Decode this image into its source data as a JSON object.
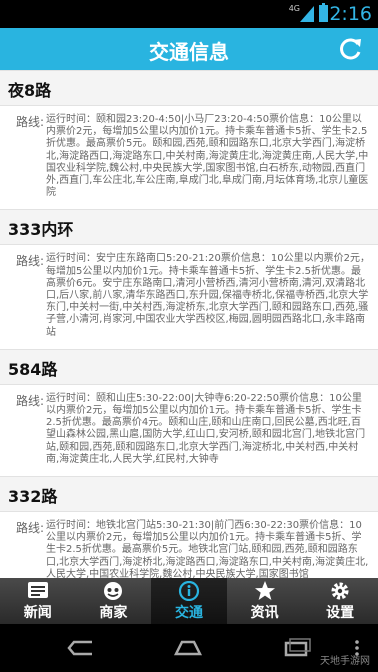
{
  "status_bar": {
    "network": "4G",
    "time": "12:16"
  },
  "header": {
    "title": "交通信息",
    "refresh_icon": "refresh-icon"
  },
  "routes": [
    {
      "name": "夜8路",
      "label": "路线:",
      "info": "运行时间：颐和园23:20-4:50|小马厂23:20-4:50票价信息：10公里以内票价2元，每增加5公里以内加价1元。持卡乘车普通卡5折、学生卡2.5折优惠。最高票价5元。颐和园,西苑,颐和园路东口,北京大学西门,海淀桥北,海淀路西口,海淀路东口,中关村南,海淀黄庄北,海淀黄庄南,人民大学,中国农业科学院,魏公村,中央民族大学,国家图书馆,白石桥东,动物园,西直门外,西直门,车公庄北,车公庄南,阜成门北,阜成门南,月坛体育场,北京儿童医院"
    },
    {
      "name": "333内环",
      "label": "路线:",
      "info": "运行时间：安宁庄东路南口5:20-21:20票价信息：10公里以内票价2元，每增加5公里以内加价1元。持卡乘车普通卡5折、学生卡2.5折优惠。最高票价6元。安宁庄东路南口,清河小营桥西,清河小营桥南,清河,双清路北口,后八家,前八家,清华东路西口,东升园,保福寺桥北,保福寺桥西,北京大学东门,中关村一街,中关村西,海淀桥东,北京大学西门,颐和园路东口,西苑,骚子营,小清河,肖家河,中国农业大学西校区,梅园,圆明园西路北口,永丰路南站"
    },
    {
      "name": "584路",
      "label": "路线:",
      "info": "运行时间：颐和山庄5:30-22:00|大钟寺6:20-22:50票价信息：10公里以内票价2元，每增加5公里以内加价1元。持卡乘车普通卡5折、学生卡2.5折优惠。最高票价4元。颐和山庄,颐和山庄南口,回民公墓,西北旺,百望山森林公园,黑山扈,国防大学,红山口,安河桥,颐和园北宫门,地铁北宫门站,颐和园,西苑,颐和园路东口,北京大学西门,海淀桥北,中关村西,中关村南,海淀黄庄北,人民大学,红民村,大钟寺"
    },
    {
      "name": "332路",
      "label": "路线:",
      "info": "运行时间：地铁北宫门站5:30-21:30|前门西6:30-22:30票价信息：10公里以内票价2元，每增加5公里以内加价1元。持卡乘车普通卡5折、学生卡2.5折优惠。最高票价5元。地铁北宫门站,颐和园,西苑,颐和园路东口,北京大学西门,海淀桥北,海淀路西口,海淀路东口,中关村南,海淀黄庄北,人民大学,中国农业科学院,魏公村,中央民族大学,国家图书馆"
    }
  ],
  "tabs": [
    {
      "label": "新闻",
      "icon": "news-icon",
      "active": false
    },
    {
      "label": "商家",
      "icon": "merchant-icon",
      "active": false
    },
    {
      "label": "交通",
      "icon": "info-icon",
      "active": true
    },
    {
      "label": "资讯",
      "icon": "star-icon",
      "active": false
    },
    {
      "label": "设置",
      "icon": "gear-icon",
      "active": false
    }
  ],
  "watermark": "天地手游网",
  "colors": {
    "accent": "#29b4e0",
    "status_accent": "#33b5e5"
  }
}
